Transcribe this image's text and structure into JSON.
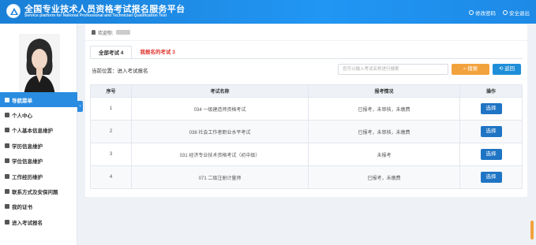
{
  "header": {
    "title": "全国专业技术人员资格考试报名服务平台",
    "subtitle": "Service platform for National Professional and Technician Qualification Test",
    "links": [
      {
        "label": "修改密码",
        "icon": "key-icon"
      },
      {
        "label": "安全退出",
        "icon": "logout-icon"
      }
    ]
  },
  "sidebar": {
    "items": [
      {
        "label": "导航菜单",
        "icon": "home-icon",
        "active": true
      },
      {
        "label": "个人中心",
        "icon": "user-icon"
      },
      {
        "label": "个人基本信息维护",
        "icon": "user-icon"
      },
      {
        "label": "学历信息维护",
        "icon": "graduation-cap-icon"
      },
      {
        "label": "学位信息维护",
        "icon": "mortarboard-icon"
      },
      {
        "label": "工作经历维护",
        "icon": "briefcase-icon"
      },
      {
        "label": "联系方式及安保问题",
        "icon": "phone-icon"
      },
      {
        "label": "我的证书",
        "icon": "certificate-icon"
      },
      {
        "label": "进入考试报名",
        "icon": "circle-icon"
      }
    ]
  },
  "welcome": {
    "label": "欢迎你:"
  },
  "tabs": [
    {
      "label": "全部考试 4",
      "active": true
    },
    {
      "label": "我报名的考试 3",
      "active": false
    }
  ],
  "location": "当前位置：进入考试报名",
  "search": {
    "placeholder": "您可以输入考试名称进行搜索",
    "button": "搜索"
  },
  "back_button": "返回",
  "table": {
    "headers": [
      "序号",
      "考试名称",
      "报考情况",
      "操作"
    ],
    "rows": [
      {
        "no": "1",
        "name": "034 一级建造师资格考试",
        "status": "已报考，未审核，未缴费",
        "action": "选择",
        "red": true
      },
      {
        "no": "2",
        "name": "038 社会工作者职业水平考试",
        "status": "已报考，未审核，未缴费",
        "action": "选择",
        "red": true
      },
      {
        "no": "3",
        "name": "031 经济专业技术资格考试（初中级）",
        "status": "未报考",
        "action": "选择",
        "red": true
      },
      {
        "no": "4",
        "name": "071 二级注册计量师",
        "status": "已报考，未缴费",
        "action": "选择",
        "red": false
      }
    ]
  },
  "colors": {
    "header_blue": "#2196f3",
    "accent_orange": "#f2a23c",
    "active_blue": "#2a8ce0",
    "red_text": "#e0342e"
  }
}
